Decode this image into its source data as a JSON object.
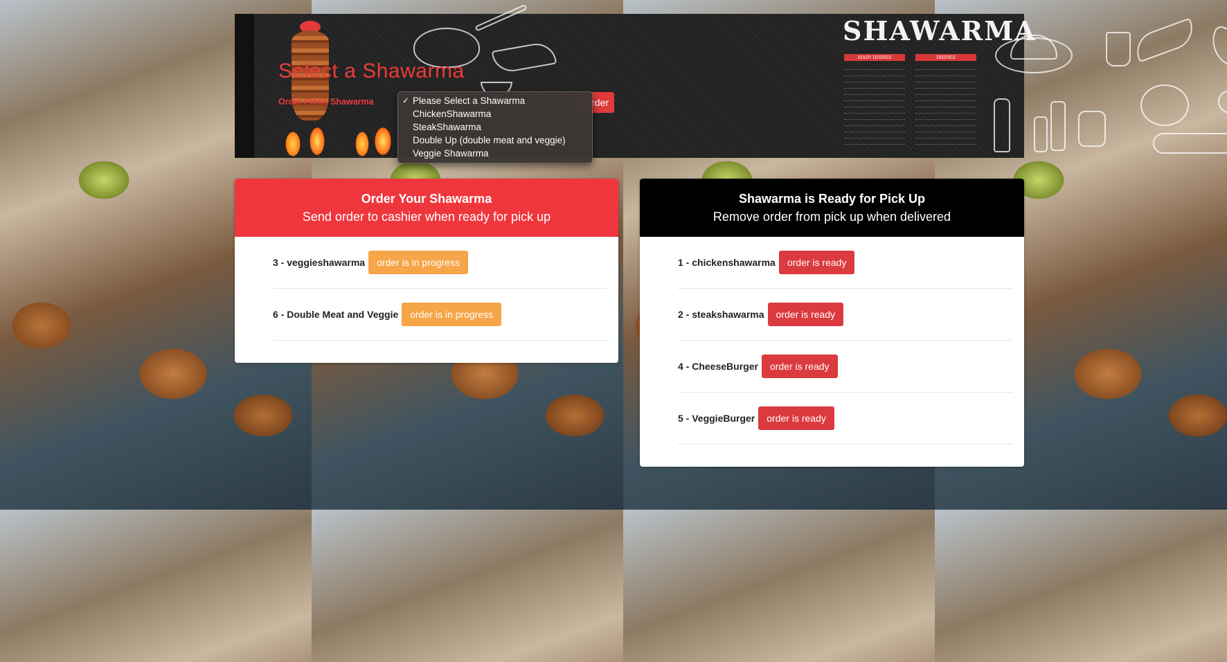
{
  "header": {
    "title": "Select a Shawarma",
    "order_label": "Order Fresh Shawarma",
    "order_button": "order",
    "brand_text": "SHAWARMA",
    "menu_columns": [
      "MAIN DISHES",
      "DRINKS"
    ],
    "menu_line_count": 13
  },
  "dropdown": {
    "selected_mark": "✓",
    "options": [
      "Please Select a Shawarma",
      "ChickenShawarma",
      "SteakShawarma",
      "Double Up (double meat and veggie)",
      "Veggie Shawarma"
    ]
  },
  "in_progress": {
    "title": "Order Your Shawarma",
    "subtitle": "Send order to cashier when ready for pick up",
    "orders": [
      {
        "label": "3 - veggieshawarma",
        "status": "order is in progress"
      },
      {
        "label": "6 - Double Meat and Veggie",
        "status": "order is in progress"
      }
    ]
  },
  "ready": {
    "title": "Shawarma is Ready for Pick Up",
    "subtitle": "Remove order from pick up when delivered",
    "orders": [
      {
        "label": "1 - chickenshawarma",
        "status": "order is ready"
      },
      {
        "label": "2 - steakshawarma",
        "status": "order is ready"
      },
      {
        "label": "4 - CheeseBurger",
        "status": "order is ready"
      },
      {
        "label": "5 - VeggieBurger",
        "status": "order is ready"
      }
    ]
  },
  "colors": {
    "accent_red": "#f0363d",
    "ready_badge": "#db3a3e",
    "progress_badge": "#f6a548",
    "banner_bg": "#232323"
  }
}
